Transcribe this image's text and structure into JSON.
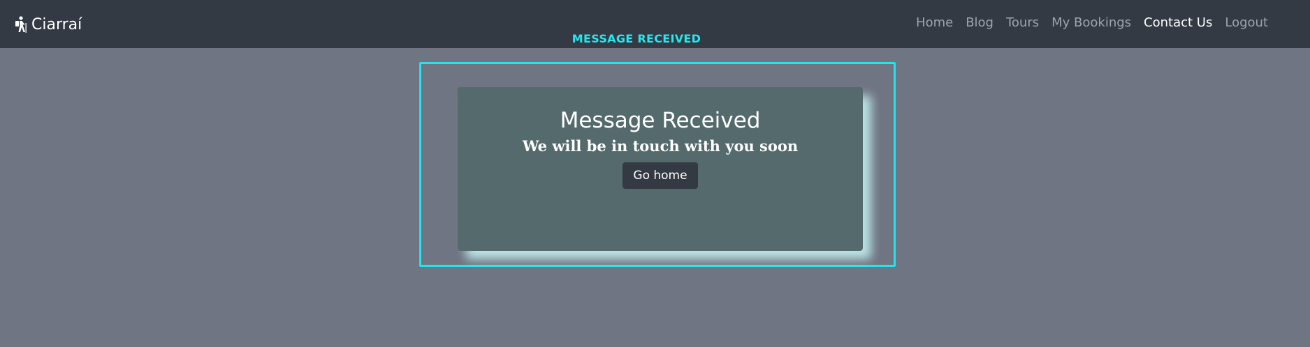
{
  "navbar": {
    "brand_icon": "hiker-icon",
    "brand": "Ciarraí",
    "links": [
      {
        "label": "Home",
        "active": false
      },
      {
        "label": "Blog",
        "active": false
      },
      {
        "label": "Tours",
        "active": false
      },
      {
        "label": "My Bookings",
        "active": false
      },
      {
        "label": "Contact Us",
        "active": true
      },
      {
        "label": "Logout",
        "active": false
      }
    ]
  },
  "section_label": "MESSAGE RECEIVED",
  "card": {
    "title": "Message Received",
    "subtitle": "We will be in touch with you soon",
    "button_label": "Go home"
  },
  "colors": {
    "navbar_bg": "#343a44",
    "page_bg": "#6f7582",
    "highlight": "#22e4ec",
    "card_bg": "#546a6c"
  }
}
